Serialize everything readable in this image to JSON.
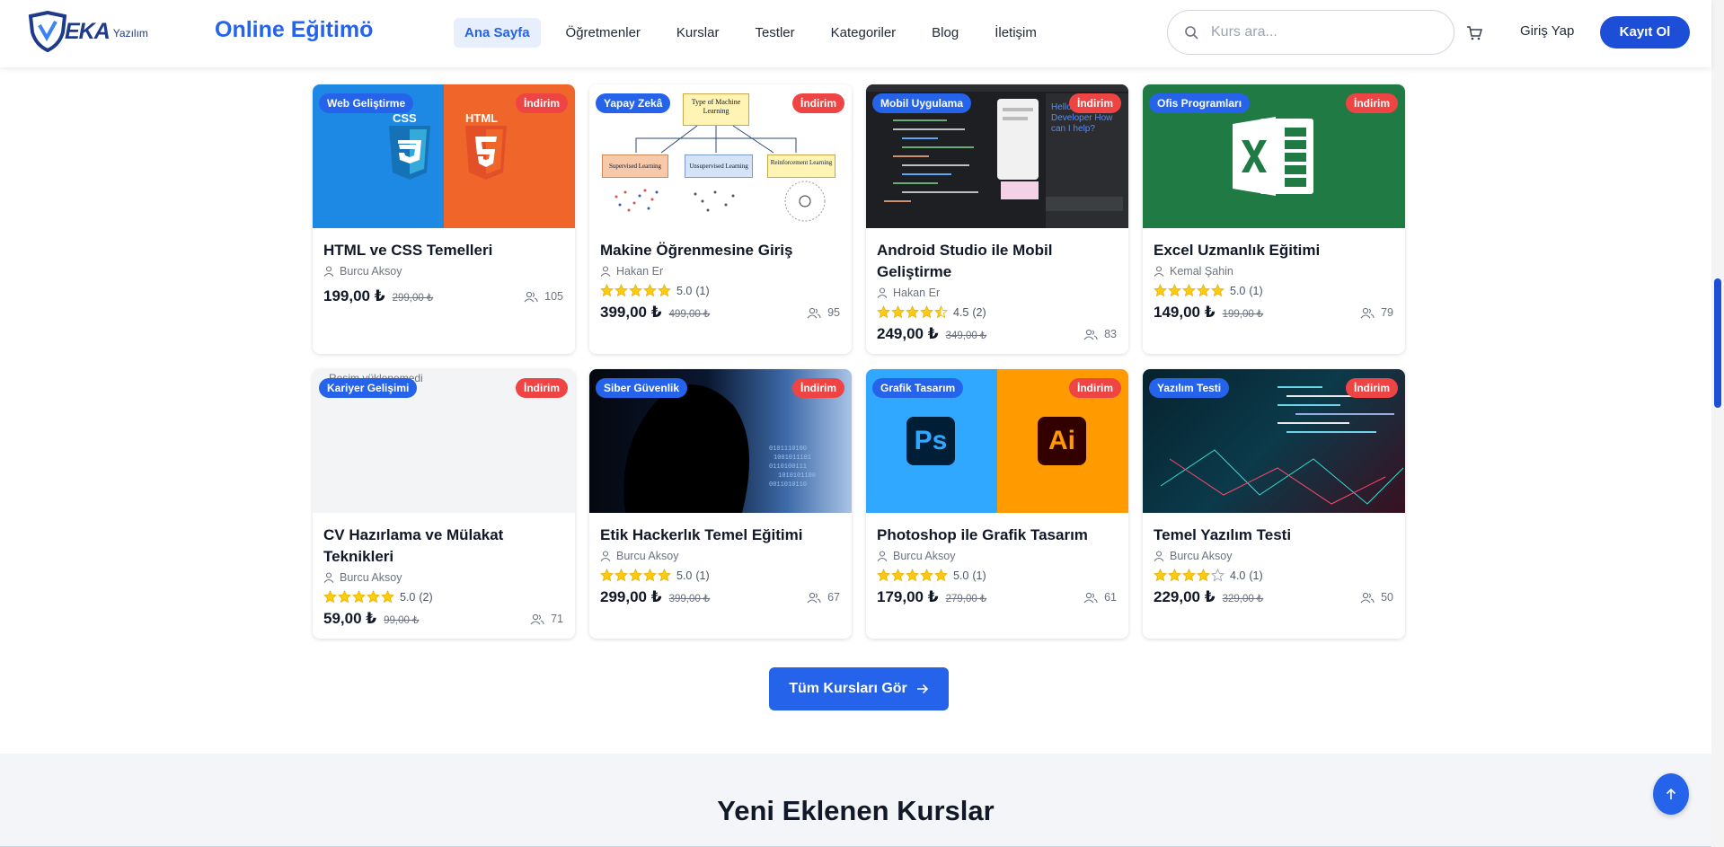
{
  "header": {
    "logo_text": "EKA",
    "logo_sub": "Yazılım",
    "site_title": "Online Eğitimö",
    "nav": [
      "Ana Sayfa",
      "Öğretmenler",
      "Kurslar",
      "Testler",
      "Kategoriler",
      "Blog",
      "İletişim"
    ],
    "active_nav": "Ana Sayfa",
    "search_placeholder": "Kurs ara...",
    "login": "Giriş Yap",
    "register": "Kayıt Ol"
  },
  "courses": [
    {
      "category": "Web Geliştirme",
      "discount": "İndirim",
      "title": "HTML ve CSS Temelleri",
      "instructor": "Burcu Aksoy",
      "rating": null,
      "rating_count": null,
      "price": "199,00 ₺",
      "old_price": "299,00 ₺",
      "students": "105"
    },
    {
      "category": "Yapay Zekâ",
      "discount": "İndirim",
      "title": "Makine Öğrenmesine Giriş",
      "instructor": "Hakan Er",
      "rating": 5.0,
      "rating_text": "5.0",
      "rating_count": "(1)",
      "price": "399,00 ₺",
      "old_price": "499,00 ₺",
      "students": "95"
    },
    {
      "category": "Mobil Uygulama",
      "discount": "İndirim",
      "title": "Android Studio ile Mobil Geliştirme",
      "instructor": "Hakan Er",
      "rating": 4.5,
      "rating_text": "4.5",
      "rating_count": "(2)",
      "price": "249,00 ₺",
      "old_price": "349,00 ₺",
      "students": "83"
    },
    {
      "category": "Ofis Programları",
      "discount": "İndirim",
      "title": "Excel Uzmanlık Eğitimi",
      "instructor": "Kemal Şahin",
      "rating": 5.0,
      "rating_text": "5.0",
      "rating_count": "(1)",
      "price": "149,00 ₺",
      "old_price": "199,00 ₺",
      "students": "79"
    },
    {
      "category": "Kariyer Gelişimi",
      "discount": "İndirim",
      "title": "CV Hazırlama ve Mülakat Teknikleri",
      "instructor": "Burcu Aksoy",
      "rating": 5.0,
      "rating_text": "5.0",
      "rating_count": "(2)",
      "price": "59,00 ₺",
      "old_price": "99,00 ₺",
      "students": "71",
      "image_alt": "Resim yüklenemedi"
    },
    {
      "category": "Siber Güvenlik",
      "discount": "İndirim",
      "title": "Etik Hackerlık Temel Eğitimi",
      "instructor": "Burcu Aksoy",
      "rating": 5.0,
      "rating_text": "5.0",
      "rating_count": "(1)",
      "price": "299,00 ₺",
      "old_price": "399,00 ₺",
      "students": "67"
    },
    {
      "category": "Grafik Tasarım",
      "discount": "İndirim",
      "title": "Photoshop ile Grafik Tasarım",
      "instructor": "Burcu Aksoy",
      "rating": 5.0,
      "rating_text": "5.0",
      "rating_count": "(1)",
      "price": "179,00 ₺",
      "old_price": "279,00 ₺",
      "students": "61"
    },
    {
      "category": "Yazılım Testi",
      "discount": "İndirim",
      "title": "Temel Yazılım Testi",
      "instructor": "Burcu Aksoy",
      "rating": 4.0,
      "rating_text": "4.0",
      "rating_count": "(1)",
      "price": "229,00 ₺",
      "old_price": "329,00 ₺",
      "students": "50"
    }
  ],
  "thumb_texts": {
    "ml_top": "Type of Machine Learning",
    "ml_a": "Supervised Learning",
    "ml_b": "Unsupervised Learning",
    "ml_c": "Reinforcement Learning",
    "css": "CSS",
    "html": "HTML",
    "ps": "Ps",
    "ai": "Ai",
    "android_chat": "Hello, Developer How can I help?"
  },
  "cta": "Tüm Kursları Gör",
  "section_title": "Yeni Eklenen Kurslar",
  "colors": {
    "primary": "#2563eb",
    "danger": "#ef4444",
    "star": "#facc15"
  }
}
